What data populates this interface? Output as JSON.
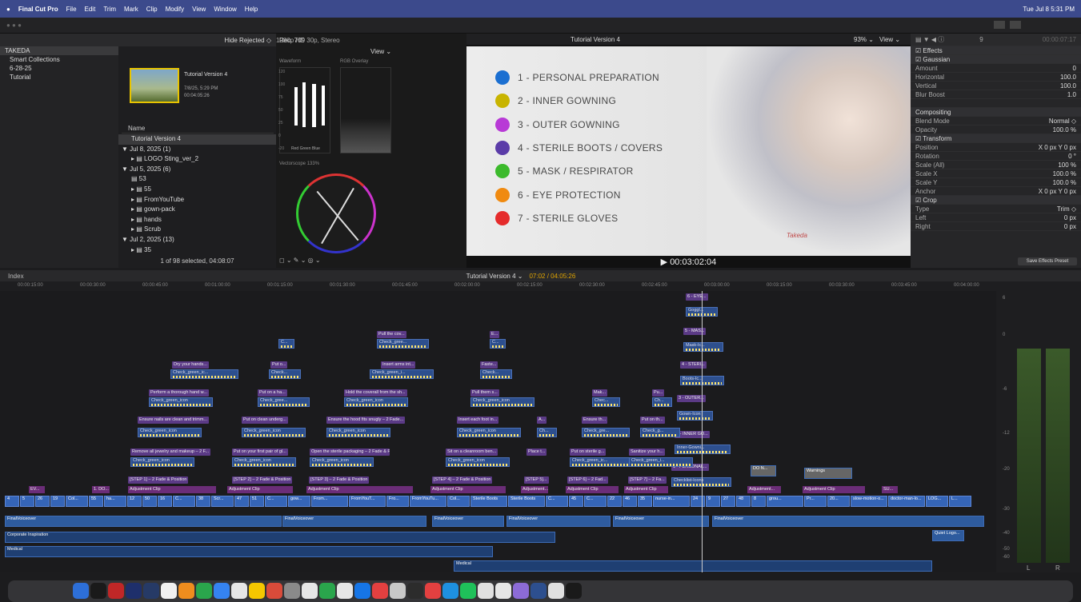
{
  "menubar": {
    "app": "Final Cut Pro",
    "items": [
      "File",
      "Edit",
      "Trim",
      "Mark",
      "Clip",
      "Modify",
      "View",
      "Window",
      "Help"
    ],
    "clock": "Tue Jul 8  5:31 PM"
  },
  "library": {
    "filter": "Hide Rejected ◇",
    "format": "1080p HD 30p, Stereo",
    "root": "TAKEDA",
    "items": [
      "Smart Collections",
      "6-28-25",
      "Tutorial"
    ]
  },
  "browser": {
    "thumb_title": "Tutorial Version 4",
    "thumb_date": "7/8/25, 5:29 PM",
    "thumb_duration": "00:04:05:26",
    "col_name": "Name",
    "rows": [
      {
        "t": "Tutorial Version 4",
        "sel": true,
        "ind": 1
      },
      {
        "t": "▼ Jul 8, 2025  (1)",
        "ind": 0
      },
      {
        "t": "▸ ▤ LOGO Sting_ver_2",
        "ind": 1
      },
      {
        "t": "▼ Jul 5, 2025  (6)",
        "ind": 0
      },
      {
        "t": "▤ 53",
        "ind": 1
      },
      {
        "t": "▸ ▤ 55",
        "ind": 1
      },
      {
        "t": "▸ ▤ FromYouTube",
        "ind": 1
      },
      {
        "t": "▸ ▤ gown-pack",
        "ind": 1
      },
      {
        "t": "▸ ▤ hands",
        "ind": 1
      },
      {
        "t": "▸ ▤ Scrub",
        "ind": 1
      },
      {
        "t": "▼ Jul 2, 2025  (13)",
        "ind": 0
      },
      {
        "t": "▸ ▤ 35",
        "ind": 1
      }
    ],
    "status": "1 of 98 selected, 04:08:07"
  },
  "scopes": {
    "title": "Rec. 709",
    "view": "View ⌄",
    "waveform": "Waveform",
    "rgb": "RGB Overlay",
    "vectorscope": "Vectorscope 133%",
    "labels": [
      "Red",
      "Green",
      "Blue"
    ],
    "scale": [
      "120",
      "100",
      "75",
      "50",
      "25",
      "0",
      "-20"
    ]
  },
  "viewer": {
    "title": "Tutorial Version 4",
    "zoom": "93% ⌄",
    "view": "View ⌄",
    "timecode": "00:03:02:04",
    "steps": [
      {
        "t": "1 - PERSONAL PREPARATION",
        "c": "#1b6fd1"
      },
      {
        "t": "2 - INNER GOWNING",
        "c": "#c8b400"
      },
      {
        "t": "3 - OUTER GOWNING",
        "c": "#b83ad6"
      },
      {
        "t": "4 - STERILE BOOTS / COVERS",
        "c": "#5b3ca8"
      },
      {
        "t": "5 - MASK / RESPIRATOR",
        "c": "#3cba2c"
      },
      {
        "t": "6 - EYE PROTECTION",
        "c": "#f08a10"
      },
      {
        "t": "7 - STERILE GLOVES",
        "c": "#e52b2b"
      }
    ],
    "watermark": "Takeda"
  },
  "inspector": {
    "top": "9",
    "dur": "00:00:07:17",
    "rows": [
      {
        "k": "☑ Effects",
        "h": true
      },
      {
        "k": "☑ Gaussian",
        "h": true
      },
      {
        "k": "Amount",
        "v": "0"
      },
      {
        "k": "Horizontal",
        "v": "100.0"
      },
      {
        "k": "Vertical",
        "v": "100.0"
      },
      {
        "k": "Blur Boost",
        "v": "1.0"
      },
      {
        "k": "",
        "v": ""
      },
      {
        "k": "Compositing",
        "h": true
      },
      {
        "k": "Blend Mode",
        "v": "Normal ◇"
      },
      {
        "k": "Opacity",
        "v": "100.0 %"
      },
      {
        "k": "☑ Transform",
        "h": true
      },
      {
        "k": "Position",
        "v": "X 0 px  Y 0 px"
      },
      {
        "k": "Rotation",
        "v": "0 °"
      },
      {
        "k": "Scale (All)",
        "v": "100 %"
      },
      {
        "k": "Scale X",
        "v": "100.0 %"
      },
      {
        "k": "Scale Y",
        "v": "100.0 %"
      },
      {
        "k": "Anchor",
        "v": "X 0 px  Y 0 px"
      },
      {
        "k": "☑ Crop",
        "h": true
      },
      {
        "k": "Type",
        "v": "Trim ◇"
      },
      {
        "k": "Left",
        "v": "0 px"
      },
      {
        "k": "Right",
        "v": "0 px"
      }
    ],
    "save": "Save Effects Preset"
  },
  "timeline": {
    "index": "Index",
    "project": "Tutorial Version 4 ⌄",
    "position": "07:02 / 04:05:26",
    "ruler": [
      "00:00:15:00",
      "00:00:30:00",
      "00:00:45:00",
      "00:01:00:00",
      "00:01:15:00",
      "00:01:30:00",
      "00:01:45:00",
      "00:02:00:00",
      "00:02:15:00",
      "00:02:30:00",
      "00:02:45:00",
      "00:03:00:00",
      "00:03:15:00",
      "00:03:30:00",
      "00:03:45:00",
      "00:04:00:00"
    ],
    "purple": [
      [
        "Dry your hands...",
        215,
        452
      ],
      [
        "Perform a thorough hand w...",
        186,
        487
      ],
      [
        "Ensure nails are clean and trimm...",
        172,
        521
      ],
      [
        "Remove all jewelry and makeup – 2 F...",
        163,
        561
      ],
      [
        "[STEP 1] – 2 Fade & Position",
        160,
        596
      ],
      [
        "Put o...",
        338,
        452
      ],
      [
        "Put on a ha...",
        322,
        487
      ],
      [
        "Put on clean underg...",
        302,
        521
      ],
      [
        "Put on your first pair of gl...",
        290,
        561
      ],
      [
        "[STEP 2] – 2 Fade & Position",
        290,
        596
      ],
      [
        "Pull the cov...",
        471,
        414
      ],
      [
        "Insert arms int...",
        476,
        452
      ],
      [
        "Hold the coverall from the sh...",
        430,
        487
      ],
      [
        "Ensure the hood fits snugly – 2 Fade...",
        408,
        521
      ],
      [
        "Open the sterile packaging – 2 Fade & Position",
        387,
        561
      ],
      [
        "[STEP 3] – 2 Fade & Position",
        386,
        596
      ],
      [
        "E...",
        612,
        414
      ],
      [
        "Faste...",
        600,
        452
      ],
      [
        "Pull them s...",
        588,
        487
      ],
      [
        "Insert each foot in...",
        571,
        521
      ],
      [
        "Sit on a cleanroom ben...",
        557,
        561
      ],
      [
        "[STEP 4] – 2 Fade & Position",
        540,
        596
      ],
      [
        "A...",
        671,
        521
      ],
      [
        "Place t...",
        658,
        561
      ],
      [
        "[STEP 5]...",
        655,
        596
      ],
      [
        "Mak...",
        740,
        487
      ],
      [
        "Ensure th...",
        727,
        521
      ],
      [
        "Put on sterile g...",
        712,
        561
      ],
      [
        "[STEP 6] – 2 Fad...",
        709,
        596
      ],
      [
        "Pu...",
        815,
        487
      ],
      [
        "Put on th...",
        800,
        521
      ],
      [
        "Sanitize your h...",
        786,
        561
      ],
      [
        "[STEP 7] – 2 Fa...",
        785,
        596
      ],
      [
        "6 - EYE...",
        857,
        367
      ],
      [
        "5 - MAS...",
        854,
        410
      ],
      [
        "4 - STERI...",
        850,
        452
      ],
      [
        "3 - OUTER...",
        846,
        494
      ],
      [
        "2 - INNER GO...",
        843,
        539
      ],
      [
        "1 - PERSONAL...",
        839,
        580
      ]
    ],
    "green": [
      [
        "Check_green_ic...",
        213,
        462
      ],
      [
        "Check_green_icon",
        186,
        497
      ],
      [
        "Check_green_icon",
        172,
        535
      ],
      [
        "Check_green_icon",
        163,
        572
      ],
      [
        "Check...",
        336,
        462
      ],
      [
        "Check_gree...",
        322,
        497
      ],
      [
        "Check_green_icon",
        302,
        535
      ],
      [
        "Check_green_icon",
        290,
        572
      ],
      [
        "Check_gree...",
        471,
        424
      ],
      [
        "Check_green_i...",
        462,
        462
      ],
      [
        "Check_green_icon",
        430,
        497
      ],
      [
        "Check_green_icon",
        408,
        535
      ],
      [
        "Check_green_icon",
        387,
        572
      ],
      [
        "C...",
        348,
        424
      ],
      [
        "C...",
        612,
        424
      ],
      [
        "Check...",
        600,
        462
      ],
      [
        "Check_green_icon",
        588,
        497
      ],
      [
        "Check_green_icon",
        571,
        535
      ],
      [
        "Check_green_icon",
        557,
        572
      ],
      [
        "Ch...",
        671,
        535
      ],
      [
        "Chec...",
        740,
        497
      ],
      [
        "Check_gre...",
        727,
        535
      ],
      [
        "Check_green_ic...",
        712,
        572
      ],
      [
        "Ch...",
        815,
        497
      ],
      [
        "Check_g...",
        800,
        535
      ],
      [
        "Check_green_i...",
        786,
        572
      ],
      [
        "Goggl...",
        857,
        384
      ],
      [
        "Mask-Ic...",
        854,
        428
      ],
      [
        "Boots-Ic...",
        850,
        470
      ],
      [
        "Gown-Icon",
        846,
        514
      ],
      [
        "Inner-Gowni...",
        843,
        556
      ],
      [
        "Checklist-Icons",
        839,
        597
      ]
    ],
    "adj": [
      [
        "Adjustment Clip",
        160,
        608,
        110
      ],
      [
        "Adjustment Clip",
        284,
        608,
        82
      ],
      [
        "Adjustment Clip",
        383,
        608,
        133
      ],
      [
        "Adjustment Clip",
        538,
        608,
        94
      ],
      [
        "Adjustment...",
        651,
        608,
        34
      ],
      [
        "Adjustment Clip",
        707,
        608,
        66
      ],
      [
        "Adjustment Clip",
        780,
        608,
        55
      ],
      [
        "Adjustment...",
        934,
        608,
        42
      ],
      [
        "Adjustment Clip",
        1003,
        608,
        78
      ],
      [
        "EV...",
        36,
        608,
        20
      ],
      [
        "1. DO...",
        115,
        608,
        22
      ],
      [
        "SU...",
        1102,
        608,
        20
      ]
    ],
    "vid_labels": [
      "4",
      "5",
      "26",
      "19",
      "Col...",
      "55",
      "ha...",
      "12",
      "50",
      "16",
      "C...",
      "38",
      "Scr...",
      "47",
      "51",
      "C...",
      "gow...",
      "From...",
      "FromYouT...",
      "Fro...",
      "FromYouTu...",
      "Col...",
      "Sterile Boots",
      "Sterile Boots",
      "C...",
      "45",
      "C...",
      "22",
      "46",
      "35",
      "nurse-in...",
      "24",
      "9",
      "27",
      "48",
      "8",
      "grou...",
      "Pr...",
      "20...",
      "slow-motion-o...",
      "doctor-man-lo...",
      "LOG...",
      "L..."
    ],
    "voice": "FinalVoiceover",
    "tracks": [
      "Corporate Inspiration",
      "Medical",
      "Medical"
    ],
    "extra": [
      "Warnings",
      "DO N...",
      "Quiet Logo..."
    ],
    "meters": [
      "6",
      "0",
      "-6",
      "-12",
      "-20",
      "-30",
      "-40",
      "-50",
      "-60"
    ],
    "meter_lr": [
      "L",
      "R"
    ]
  },
  "dock_colors": [
    "#2d6fd8",
    "#1a1a1a",
    "#c02727",
    "#1e2f6b",
    "#263a66",
    "#f0f0f0",
    "#ef8d1e",
    "#2aa54c",
    "#3583f0",
    "#e6e6e6",
    "#f5c700",
    "#d94b3a",
    "#8a8a8a",
    "#e6e6e6",
    "#2aa54c",
    "#e6e6e6",
    "#1675e6",
    "#e34040",
    "#c8c8c8",
    "#2c2c2c",
    "#e34040",
    "#1e90e0",
    "#1fc05a",
    "#e0e0e0",
    "#e6e6e6",
    "#8c6bd6",
    "#2d4f8e",
    "#e0e0e0",
    "#1a1a1a"
  ]
}
